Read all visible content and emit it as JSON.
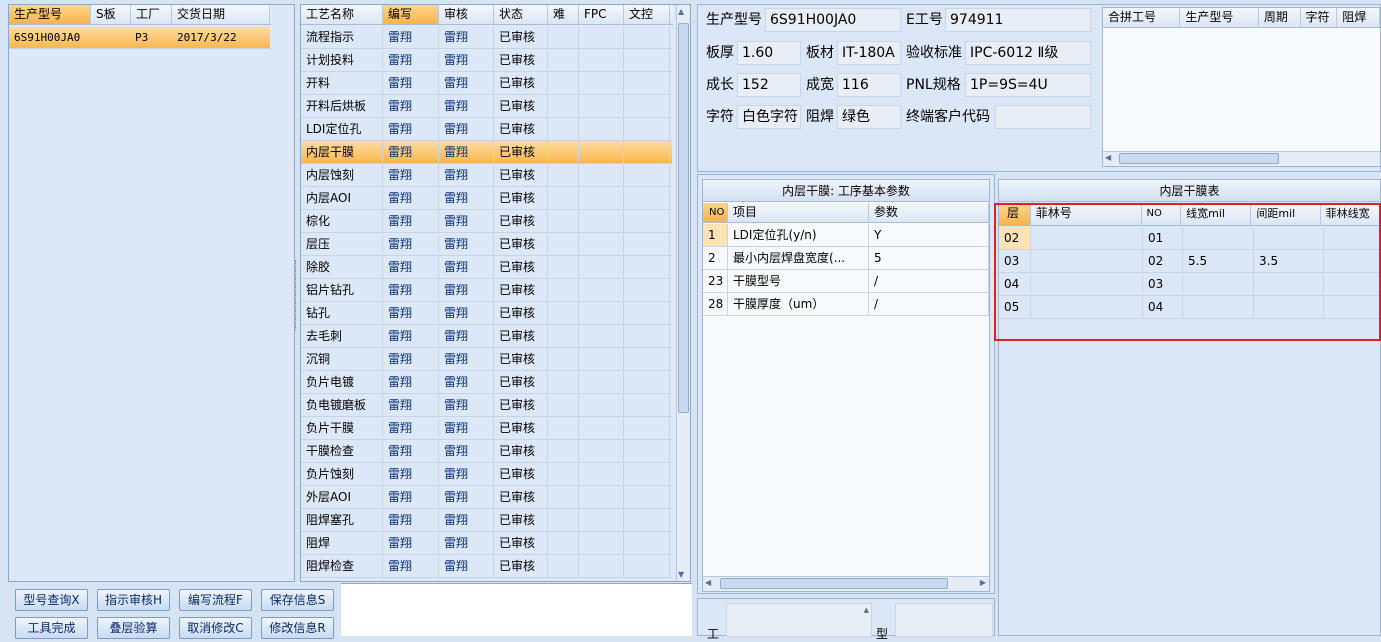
{
  "left_grid": {
    "headers": [
      "生产型号",
      "S板",
      "工厂",
      "交货日期"
    ],
    "rows": [
      [
        "6S91H00JA0",
        "",
        "P3",
        "2017/3/22"
      ]
    ]
  },
  "process_grid": {
    "headers": [
      "工艺名称",
      "编写",
      "审核",
      "状态",
      "难",
      "FPC",
      "文控"
    ],
    "rows": [
      [
        "流程指示",
        "雷翔",
        "雷翔",
        "已审核"
      ],
      [
        "计划投料",
        "雷翔",
        "雷翔",
        "已审核"
      ],
      [
        "开料",
        "雷翔",
        "雷翔",
        "已审核"
      ],
      [
        "开料后烘板",
        "雷翔",
        "雷翔",
        "已审核"
      ],
      [
        "LDI定位孔",
        "雷翔",
        "雷翔",
        "已审核"
      ],
      [
        "内层干膜",
        "雷翔",
        "雷翔",
        "已审核"
      ],
      [
        "内层蚀刻",
        "雷翔",
        "雷翔",
        "已审核"
      ],
      [
        "内层AOI",
        "雷翔",
        "雷翔",
        "已审核"
      ],
      [
        "棕化",
        "雷翔",
        "雷翔",
        "已审核"
      ],
      [
        "层压",
        "雷翔",
        "雷翔",
        "已审核"
      ],
      [
        "除胶",
        "雷翔",
        "雷翔",
        "已审核"
      ],
      [
        "铝片钻孔",
        "雷翔",
        "雷翔",
        "已审核"
      ],
      [
        "钻孔",
        "雷翔",
        "雷翔",
        "已审核"
      ],
      [
        "去毛刺",
        "雷翔",
        "雷翔",
        "已审核"
      ],
      [
        "沉铜",
        "雷翔",
        "雷翔",
        "已审核"
      ],
      [
        "负片电镀",
        "雷翔",
        "雷翔",
        "已审核"
      ],
      [
        "负电镀磨板",
        "雷翔",
        "雷翔",
        "已审核"
      ],
      [
        "负片干膜",
        "雷翔",
        "雷翔",
        "已审核"
      ],
      [
        "干膜检查",
        "雷翔",
        "雷翔",
        "已审核"
      ],
      [
        "负片蚀刻",
        "雷翔",
        "雷翔",
        "已审核"
      ],
      [
        "外层AOI",
        "雷翔",
        "雷翔",
        "已审核"
      ],
      [
        "阻焊塞孔",
        "雷翔",
        "雷翔",
        "已审核"
      ],
      [
        "阻焊",
        "雷翔",
        "雷翔",
        "已审核"
      ],
      [
        "阻焊检查",
        "雷翔",
        "雷翔",
        "已审核"
      ]
    ],
    "selected_index": 5
  },
  "buttons": {
    "row1": [
      "型号查询X",
      "指示审核H",
      "编写流程F",
      "保存信息S"
    ],
    "row2": [
      "工具完成",
      "叠层验算",
      "取消修改C",
      "修改信息R"
    ]
  },
  "info": {
    "part_no_label": "生产型号",
    "part_no": "6S91H00JA0",
    "e_no_label": "E工号",
    "e_no": "974911",
    "thickness_label": "板厚",
    "thickness": "1.60",
    "material_label": "板材",
    "material": "IT-180A",
    "std_label": "验收标准",
    "std": "IPC-6012 Ⅱ级",
    "length_label": "成长",
    "length": "152",
    "width_label": "成宽",
    "width": "116",
    "pnl_label": "PNL规格",
    "pnl": "1P=9S=4U",
    "char_label": "字符",
    "char": "白色字符",
    "mask_label": "阻焊",
    "mask": "绿色",
    "customer_label": "终端客户代码",
    "customer": ""
  },
  "merge_grid": {
    "headers": [
      "合拼工号",
      "生产型号",
      "周期",
      "字符",
      "阻焊"
    ]
  },
  "params": {
    "title": "内层干膜: 工序基本参数",
    "headers": [
      "NO",
      "项目",
      "参数"
    ],
    "rows": [
      [
        "1",
        "LDI定位孔(y/n)",
        "Y"
      ],
      [
        "2",
        "最小内层焊盘宽度(...",
        "5"
      ],
      [
        "23",
        "干膜型号",
        "/"
      ],
      [
        "28",
        "干膜厚度（um）",
        "/"
      ]
    ]
  },
  "dryfilm": {
    "title": "内层干膜表",
    "headers": [
      "层",
      "菲林号",
      "NO",
      "线宽mil",
      "间距mil",
      "菲林线宽"
    ],
    "rows": [
      [
        "02",
        "",
        "01",
        "",
        "",
        ""
      ],
      [
        "03",
        "",
        "02",
        "5.5",
        "3.5",
        ""
      ],
      [
        "04",
        "",
        "03",
        "",
        "",
        ""
      ],
      [
        "05",
        "",
        "04",
        "",
        "",
        ""
      ]
    ]
  },
  "bottom": {
    "label1": "工",
    "label2": "型"
  }
}
